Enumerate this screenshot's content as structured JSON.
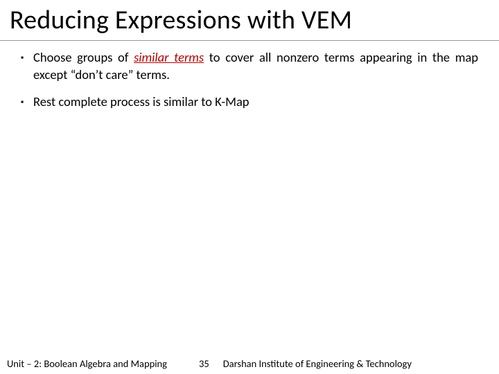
{
  "title": "Reducing Expressions with VEM",
  "bullets": [
    {
      "pre": "Choose groups of ",
      "emph": "similar terms",
      "post": " to cover all nonzero terms appearing in the map except “don’t care” terms."
    },
    {
      "pre": "Rest complete process is similar to K-Map",
      "emph": "",
      "post": ""
    }
  ],
  "footer": {
    "left": "Unit – 2: Boolean Algebra and Mapping",
    "page": "35",
    "right": "Darshan Institute of Engineering & Technology"
  }
}
